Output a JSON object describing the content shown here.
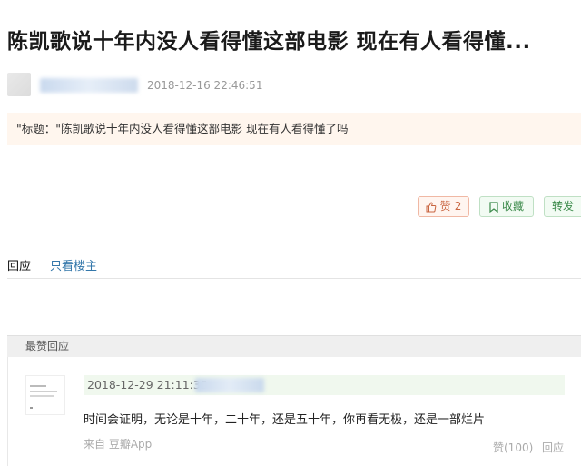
{
  "post": {
    "title": "陈凯歌说十年内没人看得懂这部电影 现在有人看得懂...",
    "timestamp": "2018-12-16 22:46:51",
    "quote": "\"标题：\"陈凯歌说十年内没人看得懂这部电影 现在有人看得懂了吗"
  },
  "actions": {
    "like_label": "赞",
    "like_count": "2",
    "favorite_label": "收藏",
    "share_label": "转发"
  },
  "tabs": {
    "reply": "回应",
    "op_only": "只看楼主"
  },
  "best_replies": {
    "header": "最赞回应",
    "items": [
      {
        "timestamp": "2018-12-29 21:11:35",
        "text": "时间会证明，无论是十年，二十年，还是五十年，你再看无极，还是一部烂片",
        "source": "来自 豆瓣App",
        "like": "赞(100)",
        "respond": "回应"
      }
    ]
  },
  "colors": {
    "like_accent": "#c8643f",
    "fav_accent": "#3b8a4a",
    "link": "#3377aa"
  }
}
